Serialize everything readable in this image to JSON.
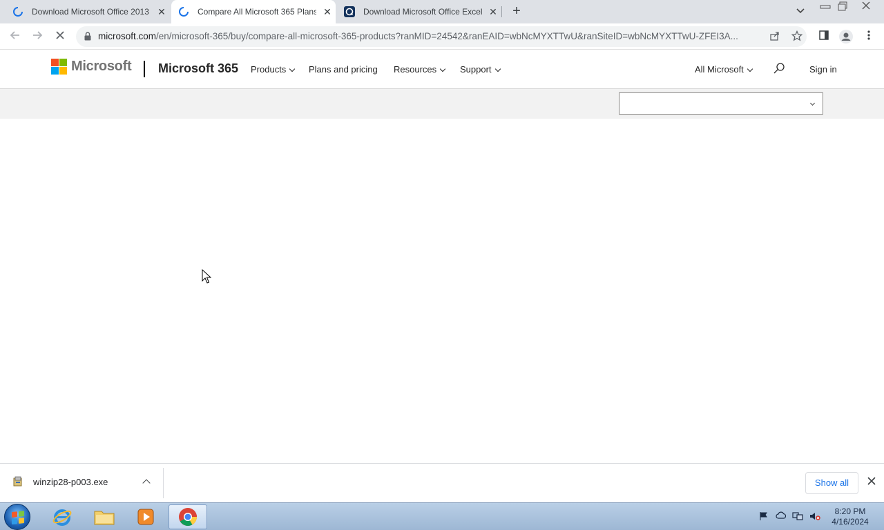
{
  "browser": {
    "tabs": [
      {
        "title": "Download Microsoft Office 2013",
        "icon": "loading-spinner-icon",
        "active": false
      },
      {
        "title": "Compare All Microsoft 365 Plans",
        "icon": "loading-spinner-icon",
        "active": true
      },
      {
        "title": "Download Microsoft Office Excel",
        "icon": "site-favicon-icon",
        "active": false
      }
    ],
    "close_glyph": "✕",
    "new_tab_glyph": "+",
    "url_domain": "microsoft.com",
    "url_path": "/en/microsoft-365/buy/compare-all-microsoft-365-products?ranMID=24542&ranEAID=wbNcMYXTTwU&ranSiteID=wbNcMYXTTwU-ZFEI3A..."
  },
  "site_header": {
    "logo_text": "Microsoft",
    "brand": "Microsoft 365",
    "nav": [
      {
        "label": "Products",
        "has_menu": true
      },
      {
        "label": "Plans and pricing",
        "has_menu": false
      },
      {
        "label": "Resources",
        "has_menu": true
      },
      {
        "label": "Support",
        "has_menu": true
      }
    ],
    "all_microsoft": "All Microsoft",
    "sign_in": "Sign in",
    "logo_colors": [
      "#f25022",
      "#7fba00",
      "#00a4ef",
      "#ffb900"
    ]
  },
  "filter": {
    "selected": ""
  },
  "downloads": {
    "file_name": "winzip28-p003.exe",
    "show_all": "Show all"
  },
  "taskbar": {
    "time": "8:20 PM",
    "date": "4/16/2024",
    "apps": [
      "internet-explorer-icon",
      "file-explorer-icon",
      "media-player-icon",
      "chrome-icon"
    ]
  }
}
